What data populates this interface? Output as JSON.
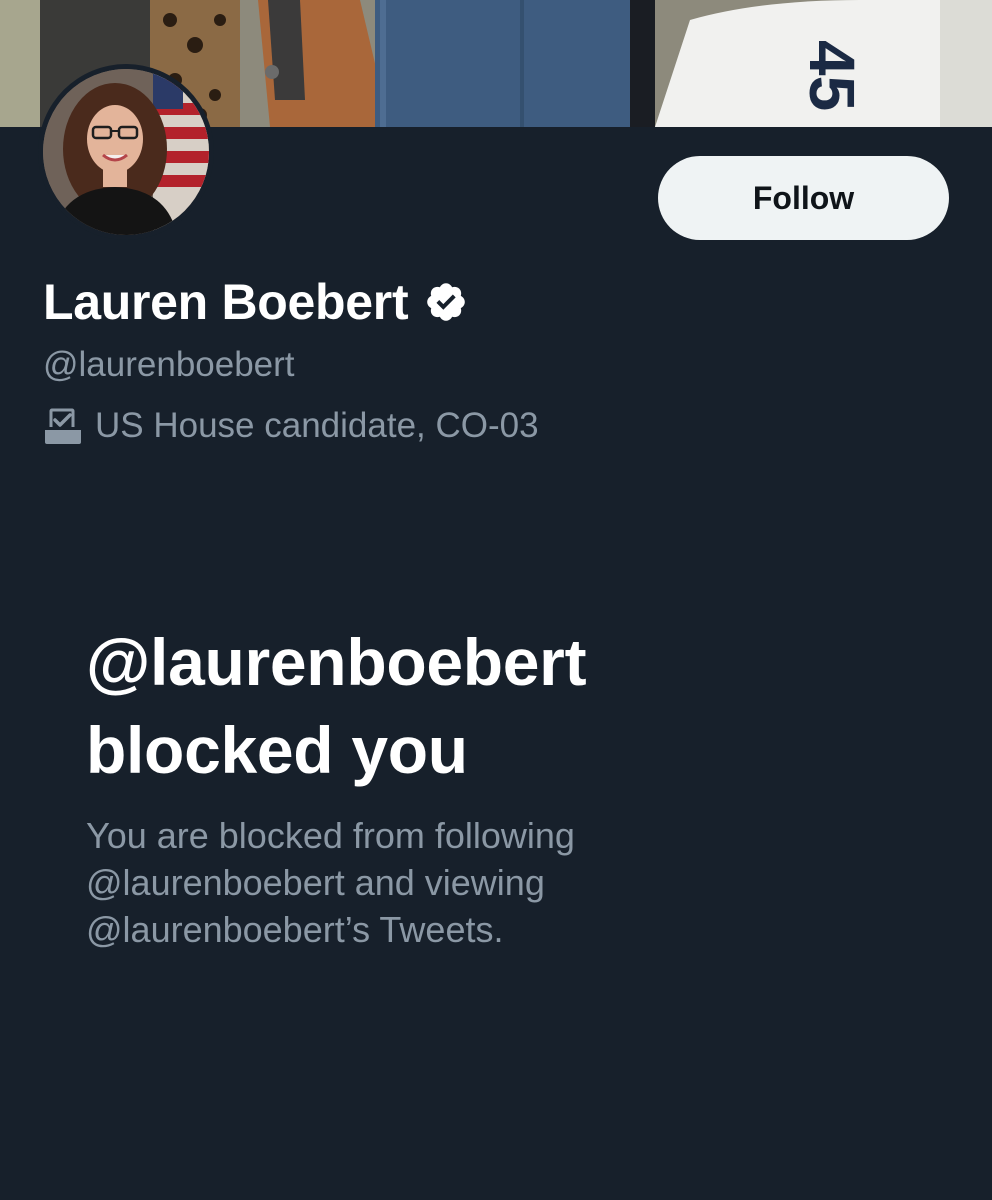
{
  "profile": {
    "display_name": "Lauren Boebert",
    "handle": "@laurenboebert",
    "bio": "US House candidate, CO-03",
    "verified": true,
    "banner_text": "45"
  },
  "actions": {
    "follow_label": "Follow"
  },
  "blocked": {
    "title_line1": "@laurenboebert",
    "title_line2": "blocked you",
    "desc_line1": "You are blocked from following",
    "desc_line2": "@laurenboebert and viewing",
    "desc_line3": "@laurenboebert’s Tweets."
  },
  "icons": {
    "verified": "verified-badge-icon",
    "bio": "ballot-box-icon"
  },
  "colors": {
    "background": "#17202b",
    "primary_text": "#ffffff",
    "secondary_text": "#8b98a5",
    "follow_button_bg": "#eff3f4",
    "follow_button_text": "#0f1419"
  }
}
